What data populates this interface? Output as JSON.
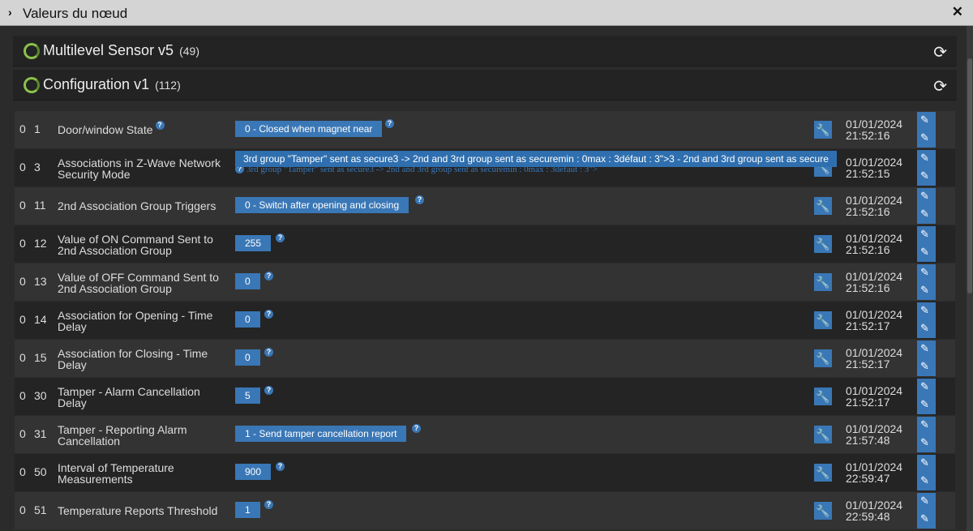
{
  "window": {
    "title": "Valeurs du nœud",
    "collapse_glyph": "›",
    "close_glyph": "✕"
  },
  "panels": [
    {
      "title": "Multilevel Sensor v5",
      "count": "(49)"
    },
    {
      "title": "Configuration v1",
      "count": "(112)"
    }
  ],
  "rows": [
    {
      "inst": "0",
      "idx": "1",
      "name": "Door/window State",
      "value": "0 - Closed when magnet near",
      "date": "01/01/2024",
      "time": "21:52:16"
    },
    {
      "inst": "0",
      "idx": "3",
      "name": "Associations in Z-Wave Network Security Mode",
      "value": "",
      "date": "01/01/2024",
      "time": "21:52:15"
    },
    {
      "inst": "0",
      "idx": "11",
      "name": "2nd Association Group Triggers",
      "value": "0 - Switch after opening and closing",
      "date": "01/01/2024",
      "time": "21:52:16"
    },
    {
      "inst": "0",
      "idx": "12",
      "name": "Value of ON Command Sent to 2nd Association Group",
      "value": "255",
      "date": "01/01/2024",
      "time": "21:52:16"
    },
    {
      "inst": "0",
      "idx": "13",
      "name": "Value of OFF Command Sent to 2nd Association Group",
      "value": "0",
      "date": "01/01/2024",
      "time": "21:52:16"
    },
    {
      "inst": "0",
      "idx": "14",
      "name": "Association for Opening - Time Delay",
      "value": "0",
      "date": "01/01/2024",
      "time": "21:52:17"
    },
    {
      "inst": "0",
      "idx": "15",
      "name": "Association for Closing - Time Delay",
      "value": "0",
      "date": "01/01/2024",
      "time": "21:52:17"
    },
    {
      "inst": "0",
      "idx": "30",
      "name": "Tamper - Alarm Cancellation Delay",
      "value": "5",
      "date": "01/01/2024",
      "time": "21:52:17"
    },
    {
      "inst": "0",
      "idx": "31",
      "name": "Tamper - Reporting Alarm Cancellation",
      "value": "1 - Send tamper cancellation report",
      "date": "01/01/2024",
      "time": "21:57:48"
    },
    {
      "inst": "0",
      "idx": "50",
      "name": "Interval of Temperature Measurements",
      "value": "900",
      "date": "01/01/2024",
      "time": "22:59:47"
    },
    {
      "inst": "0",
      "idx": "51",
      "name": "Temperature Reports Threshold",
      "value": "1",
      "date": "01/01/2024",
      "time": "22:59:48"
    }
  ],
  "row3_overlay": "3rd group \"Tamper\" sent as secure3 -> 2nd and 3rd group sent as securemin : 0max : 3défaut : 3\">3 - 2nd and 3rd group sent as secure",
  "row3_underlay": "3rd group \"Tamper\" sent as secure3 -> 2nd and 3rd group sent as securemin : 0max : 3défaut : 3\">",
  "icons": {
    "help": "?",
    "wrench": "🔧",
    "refresh": "⟳",
    "pipette": "✎",
    "pencil": "✎",
    "accent": "#3a77b6",
    "status_ring": "#8bc34a"
  }
}
